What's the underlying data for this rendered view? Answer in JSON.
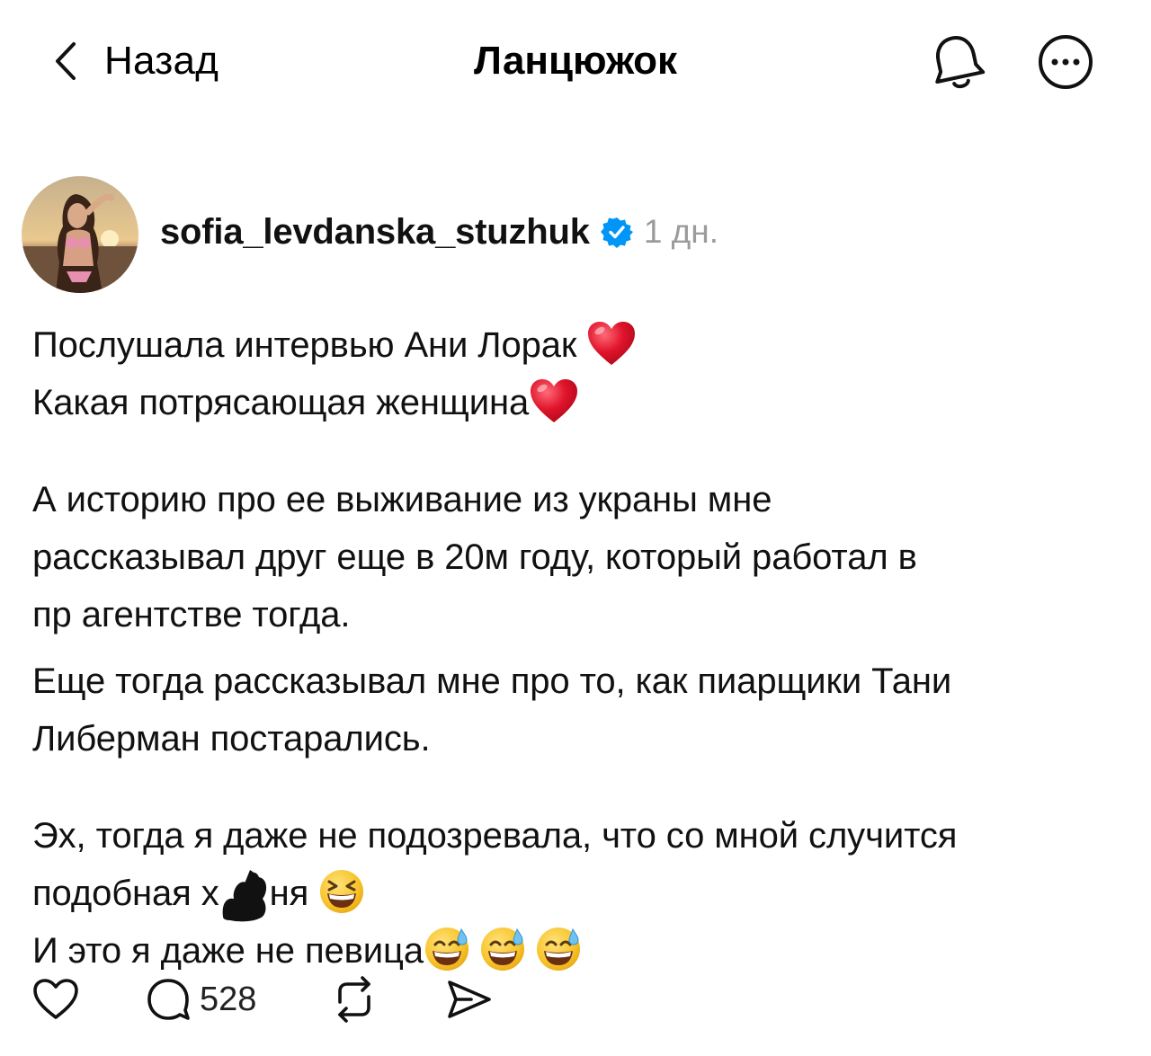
{
  "header": {
    "back_label": "Назад",
    "title": "Ланцюжок",
    "icons": [
      "chevron-left-icon",
      "bell-icon",
      "more-icon"
    ]
  },
  "post": {
    "username": "sofia_levdanska_stuzhuk",
    "verified": true,
    "time": "1 дн.",
    "paragraphs": [
      {
        "lines": [
          {
            "text": "Послушала интервью Ани Лорак ",
            "emoji": [
              "heart"
            ]
          },
          {
            "text": "Какая потрясающая женщина",
            "emoji": [
              "heart"
            ]
          }
        ]
      },
      {
        "lines": [
          {
            "text": "А историю про ее выживание из украны мне"
          },
          {
            "text": "рассказывал друг еще в 20м году, который работал в"
          },
          {
            "text": "пр агентстве тогда."
          },
          {
            "text": "Еще тогда рассказывал мне про то, как пиарщики Тани"
          },
          {
            "text": "Либерман постарались."
          }
        ]
      },
      {
        "lines": [
          {
            "text": "Эх, тогда я даже не подозревала, что со мной случится"
          },
          {
            "text_before": "подобная х",
            "text_after": "ня ",
            "emoji": [
              "grinning-squinting"
            ]
          },
          {
            "text": "И это я даже не певица",
            "emoji": [
              "grinning-sweat",
              "grinning-sweat",
              "grinning-sweat"
            ]
          }
        ]
      }
    ]
  },
  "actions": {
    "reply_count": "528",
    "icons": [
      "heart-outline-icon",
      "comment-icon",
      "repost-icon",
      "share-icon"
    ]
  },
  "colors": {
    "text": "#111111",
    "muted": "#9b9b9b",
    "verified": "#0095f6",
    "heart": "#e0142b",
    "emoji_face": "#f7c328"
  }
}
